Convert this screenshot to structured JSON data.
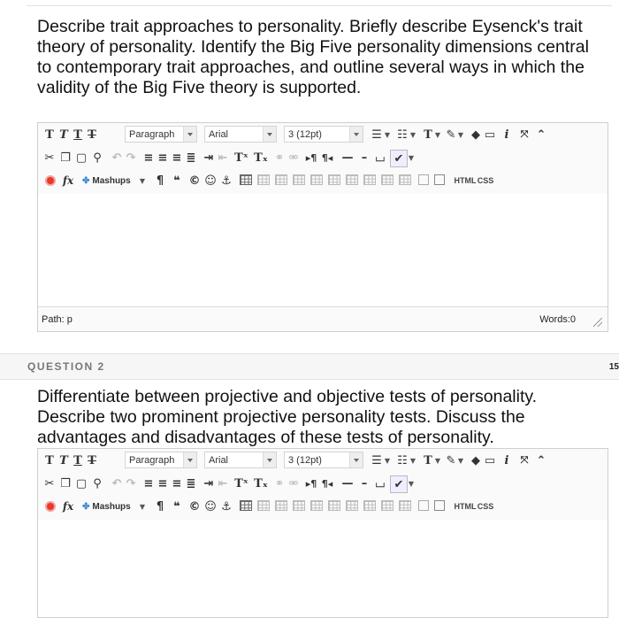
{
  "questions": [
    {
      "prompt": "Describe trait approaches to personality. Briefly describe Eysenck's trait theory of personality. Identify the Big Five personality dimensions central to contemporary trait approaches, and outline several ways in which the validity of the Big Five theory is supported.",
      "path_label": "Path: p",
      "words_label": "Words:0"
    },
    {
      "header": "QUESTION 2",
      "points": "15",
      "prompt": "Differentiate between projective and objective tests of personality. Describe two prominent projective personality tests. Discuss the advantages and disadvantages of these tests of personality."
    }
  ],
  "toolbar": {
    "format_select": "Paragraph",
    "font_select": "Arial",
    "size_select": "3 (12pt)",
    "mashups_label": "Mashups",
    "html_label": "HTML",
    "css_label": "CSS",
    "fx_label": "fx",
    "superscript_label": "Tˣ",
    "subscript_label": "Tₓ"
  },
  "colors": {
    "accent_red": "#e8382b",
    "border": "#cfcfcf",
    "toolbar_bg": "#fafafa"
  }
}
